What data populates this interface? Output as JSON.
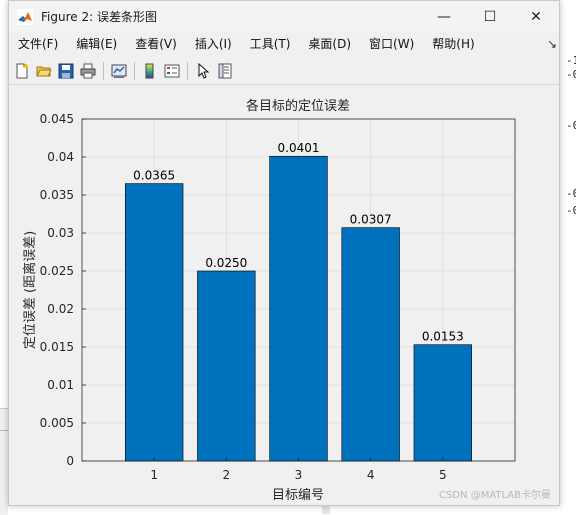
{
  "window": {
    "title": "Figure 2: 误差条形图",
    "controls": {
      "minimize": "—",
      "maximize": "☐",
      "close": "✕"
    }
  },
  "menu": {
    "items": [
      "文件(F)",
      "编辑(E)",
      "查看(V)",
      "插入(I)",
      "工具(T)",
      "桌面(D)",
      "窗口(W)",
      "帮助(H)"
    ],
    "overflow": "↘"
  },
  "toolbar": {
    "icons": [
      "new-figure-icon",
      "open-file-icon",
      "save-icon",
      "print-icon",
      "link-plot-icon",
      "colorbar-icon",
      "legend-icon",
      "pointer-icon",
      "property-editor-icon"
    ]
  },
  "background": {
    "right_fragments": [
      "-1",
      "-0",
      "-0",
      "-0",
      "-0"
    ]
  },
  "watermark": "CSDN @MATLAB卡尔曼",
  "chart_data": {
    "type": "bar",
    "title": "各目标的定位误差",
    "xlabel": "目标编号",
    "ylabel": "定位误差 (距离误差)",
    "categories": [
      "1",
      "2",
      "3",
      "4",
      "5"
    ],
    "values": [
      0.0365,
      0.025,
      0.0401,
      0.0307,
      0.0153
    ],
    "value_labels": [
      "0.0365",
      "0.0250",
      "0.0401",
      "0.0307",
      "0.0153"
    ],
    "ylim": [
      0,
      0.045
    ],
    "yticks": [
      "0",
      "0.005",
      "0.01",
      "0.015",
      "0.02",
      "0.025",
      "0.03",
      "0.035",
      "0.04",
      "0.045"
    ],
    "grid": true,
    "bar_color": "#0072bd"
  }
}
